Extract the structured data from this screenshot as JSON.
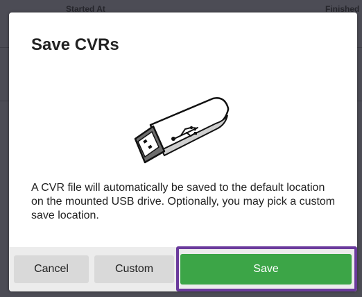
{
  "background": {
    "column_started": "Started At",
    "column_finished": "Finished"
  },
  "modal": {
    "title": "Save CVRs",
    "description": "A CVR file will automatically be saved to the default location on the mounted USB drive. Optionally, you may pick a custom save location.",
    "illustration_icon": "usb-drive-icon",
    "buttons": {
      "cancel": "Cancel",
      "custom": "Custom",
      "save": "Save"
    }
  },
  "colors": {
    "save_button": "#3ca547",
    "focus_ring": "#6a3a9c",
    "footer": "#ececec",
    "secondary_button": "#d9d9d9"
  }
}
